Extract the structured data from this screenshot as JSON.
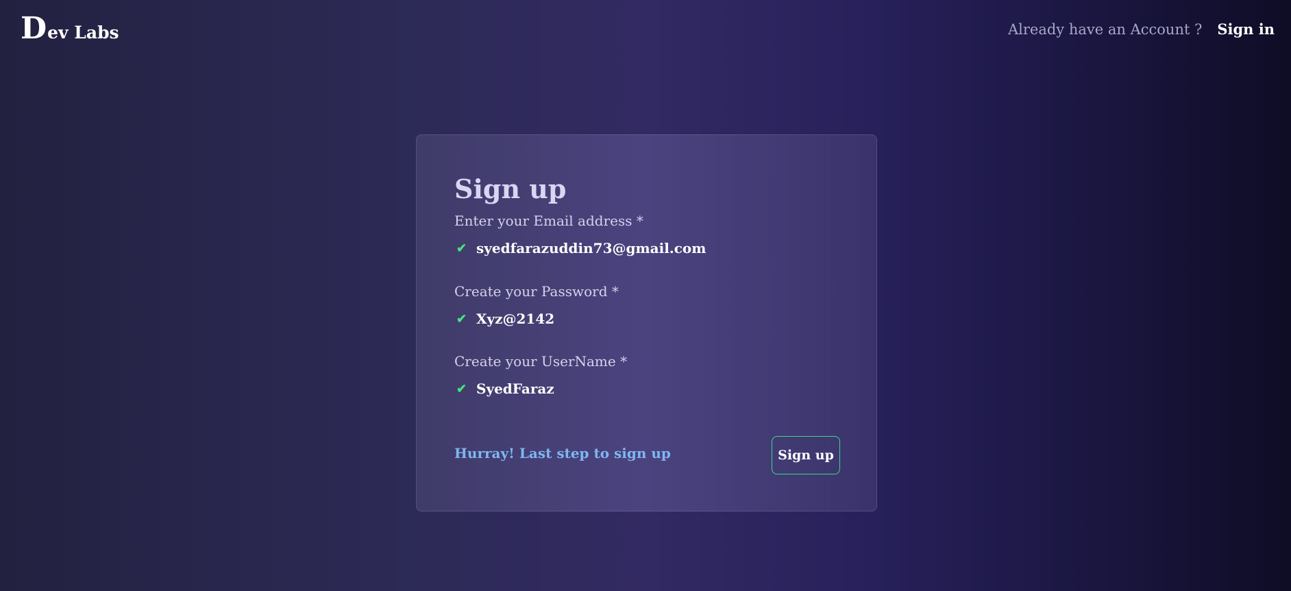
{
  "header": {
    "logo_initial": "D",
    "logo_rest": "ev Labs",
    "account_prompt": "Already have an Account ?",
    "signin_label": "Sign in"
  },
  "form": {
    "title": "Sign up",
    "fields": [
      {
        "label": "Enter your Email address *",
        "value": "syedfarazuddin73@gmail.com",
        "status_icon": "check-icon"
      },
      {
        "label": "Create your Password *",
        "value": "Xyz@2142",
        "status_icon": "check-icon"
      },
      {
        "label": "Create your UserName *",
        "value": "SyedFaraz",
        "status_icon": "check-icon"
      }
    ],
    "status_message": "Hurray! Last step to sign up",
    "submit_label": "Sign up"
  },
  "colors": {
    "check": "#4ade80",
    "button_border": "#3fd68a",
    "status_message": "#7fb6f2"
  }
}
